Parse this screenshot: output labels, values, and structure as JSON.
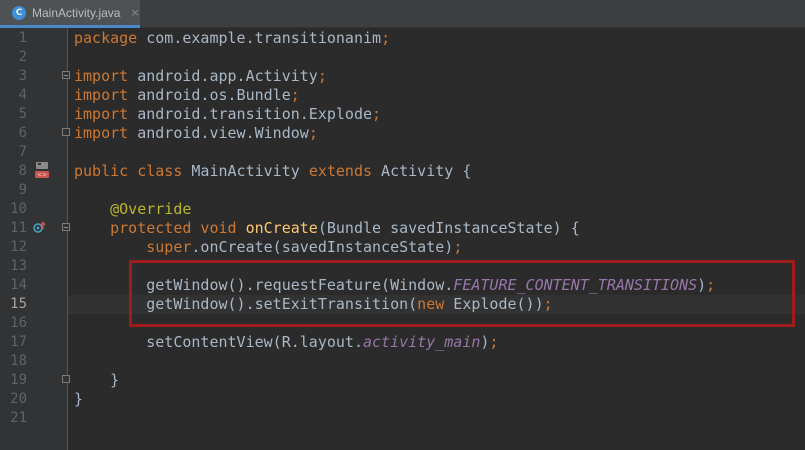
{
  "tab": {
    "icon_letter": "C",
    "label": "MainActivity.java",
    "close_glyph": "×"
  },
  "current_line": 15,
  "gutter_icons": {
    "class_icon": "android-class-icon",
    "override_icon": "override-method-icon"
  },
  "colors": {
    "keyword": "#cc7832",
    "annotation": "#bbb529",
    "method_declaration": "#ffc66d",
    "static_field": "#9876aa",
    "plain": "#a9b7c6",
    "highlight_box": "#a01c1c",
    "background": "#2b2b2b"
  },
  "lines": [
    {
      "n": "1",
      "tokens": [
        {
          "t": "package",
          "c": "kw"
        },
        {
          "t": " com.example.transitionanim",
          "c": "pl"
        },
        {
          "t": ";",
          "c": "kw"
        }
      ]
    },
    {
      "n": "2",
      "tokens": []
    },
    {
      "n": "3",
      "tokens": [
        {
          "t": "import",
          "c": "kw"
        },
        {
          "t": " android.app.Activity",
          "c": "pl"
        },
        {
          "t": ";",
          "c": "kw"
        }
      ]
    },
    {
      "n": "4",
      "tokens": [
        {
          "t": "import",
          "c": "kw"
        },
        {
          "t": " android.os.Bundle",
          "c": "pl"
        },
        {
          "t": ";",
          "c": "kw"
        }
      ]
    },
    {
      "n": "5",
      "tokens": [
        {
          "t": "import",
          "c": "kw"
        },
        {
          "t": " android.transition.Explode",
          "c": "pl"
        },
        {
          "t": ";",
          "c": "kw"
        }
      ]
    },
    {
      "n": "6",
      "tokens": [
        {
          "t": "import",
          "c": "kw"
        },
        {
          "t": " android.view.Window",
          "c": "pl"
        },
        {
          "t": ";",
          "c": "kw"
        }
      ]
    },
    {
      "n": "7",
      "tokens": []
    },
    {
      "n": "8",
      "tokens": [
        {
          "t": "public class",
          "c": "kw"
        },
        {
          "t": " MainActivity ",
          "c": "pl"
        },
        {
          "t": "extends",
          "c": "kw"
        },
        {
          "t": " Activity {",
          "c": "pl"
        }
      ]
    },
    {
      "n": "9",
      "tokens": []
    },
    {
      "n": "10",
      "tokens": [
        {
          "t": "    ",
          "c": "pl"
        },
        {
          "t": "@Override",
          "c": "ann"
        }
      ]
    },
    {
      "n": "11",
      "tokens": [
        {
          "t": "    ",
          "c": "pl"
        },
        {
          "t": "protected void",
          "c": "kw"
        },
        {
          "t": " ",
          "c": "pl"
        },
        {
          "t": "onCreate",
          "c": "fn"
        },
        {
          "t": "(Bundle savedInstanceState) {",
          "c": "pl"
        }
      ]
    },
    {
      "n": "12",
      "tokens": [
        {
          "t": "        ",
          "c": "pl"
        },
        {
          "t": "super",
          "c": "kw"
        },
        {
          "t": ".onCreate(savedInstanceState)",
          "c": "pl"
        },
        {
          "t": ";",
          "c": "kw"
        }
      ]
    },
    {
      "n": "13",
      "tokens": []
    },
    {
      "n": "14",
      "tokens": [
        {
          "t": "        getWindow().requestFeature(Window.",
          "c": "pl"
        },
        {
          "t": "FEATURE_CONTENT_TRANSITIONS",
          "c": "st"
        },
        {
          "t": ")",
          "c": "pl"
        },
        {
          "t": ";",
          "c": "kw"
        }
      ]
    },
    {
      "n": "15",
      "tokens": [
        {
          "t": "        getWindow().setExitTransition(",
          "c": "pl"
        },
        {
          "t": "new",
          "c": "kw"
        },
        {
          "t": " Explode())",
          "c": "pl"
        },
        {
          "t": ";",
          "c": "kw"
        }
      ]
    },
    {
      "n": "16",
      "tokens": []
    },
    {
      "n": "17",
      "tokens": [
        {
          "t": "        setContentView(R.layout.",
          "c": "pl"
        },
        {
          "t": "activity_main",
          "c": "st"
        },
        {
          "t": ")",
          "c": "pl"
        },
        {
          "t": ";",
          "c": "kw"
        }
      ]
    },
    {
      "n": "18",
      "tokens": []
    },
    {
      "n": "19",
      "tokens": [
        {
          "t": "    }",
          "c": "pl"
        }
      ]
    },
    {
      "n": "20",
      "tokens": [
        {
          "t": "}",
          "c": "pl"
        }
      ]
    },
    {
      "n": "21",
      "tokens": []
    }
  ]
}
